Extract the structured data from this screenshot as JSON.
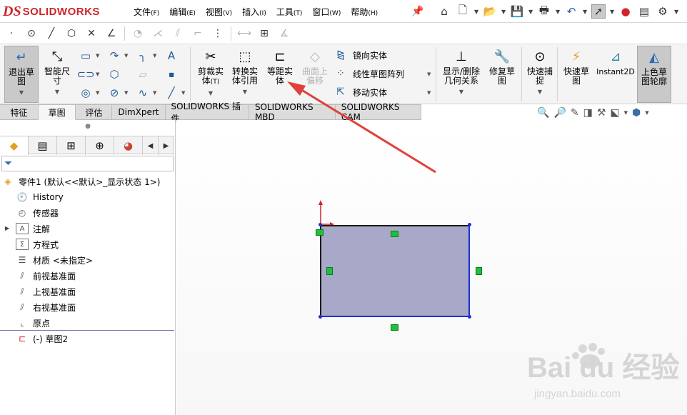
{
  "app": {
    "logo_ds": "DS",
    "logo_text": "SOLIDWORKS"
  },
  "menus": [
    {
      "label": "文件",
      "key": "(F)"
    },
    {
      "label": "编辑",
      "key": "(E)"
    },
    {
      "label": "视图",
      "key": "(V)"
    },
    {
      "label": "插入",
      "key": "(I)"
    },
    {
      "label": "工具",
      "key": "(T)"
    },
    {
      "label": "窗口",
      "key": "(W)"
    },
    {
      "label": "帮助",
      "key": "(H)"
    }
  ],
  "ribbon": {
    "exit_sketch": "退出草图",
    "smart_dim": "智能尺寸",
    "trim": "剪裁实体",
    "trim_key": "(T)",
    "convert": "转换实体引用",
    "offset": "等距实体",
    "offset_surface": "曲面上偏移",
    "mirror": "镜向实体",
    "linear_pattern": "线性草图阵列",
    "move": "移动实体",
    "show_delete": "显示/删除几何关系",
    "repair": "修复草图",
    "quick_snap": "快速捕捉",
    "rapid_sketch": "快速草图",
    "instant2d": "Instant2D",
    "shaded_sketch": "上色草图轮廓"
  },
  "tabs": [
    {
      "label": "特征",
      "active": false
    },
    {
      "label": "草图",
      "active": true
    },
    {
      "label": "评估",
      "active": false
    },
    {
      "label": "DimXpert",
      "active": false
    },
    {
      "label": "SOLIDWORKS 插件",
      "active": false
    },
    {
      "label": "SOLIDWORKS MBD",
      "active": false
    },
    {
      "label": "SOLIDWORKS CAM",
      "active": false
    }
  ],
  "tree": {
    "root": "零件1 (默认<<默认>_显示状态 1>)",
    "items": [
      {
        "label": "History",
        "icon": "history-icon"
      },
      {
        "label": "传感器",
        "icon": "sensor-icon"
      },
      {
        "label": "注解",
        "icon": "annotation-icon",
        "expandable": true
      },
      {
        "label": "方程式",
        "icon": "equation-icon"
      },
      {
        "label": "材质 <未指定>",
        "icon": "material-icon"
      },
      {
        "label": "前视基准面",
        "icon": "plane-icon"
      },
      {
        "label": "上视基准面",
        "icon": "plane-icon"
      },
      {
        "label": "右视基准面",
        "icon": "plane-icon"
      },
      {
        "label": "原点",
        "icon": "origin-icon"
      },
      {
        "label": "(-) 草图2",
        "icon": "sketch-icon"
      }
    ]
  },
  "colors": {
    "sketch_fill": "#a8a9c8",
    "sketch_edge": "#1d2fd6",
    "relation_marker": "#1fbf3c",
    "arrow": "#e0413c"
  },
  "watermark": {
    "brand": "Bai du 经验",
    "url": "jingyan.baidu.com"
  }
}
